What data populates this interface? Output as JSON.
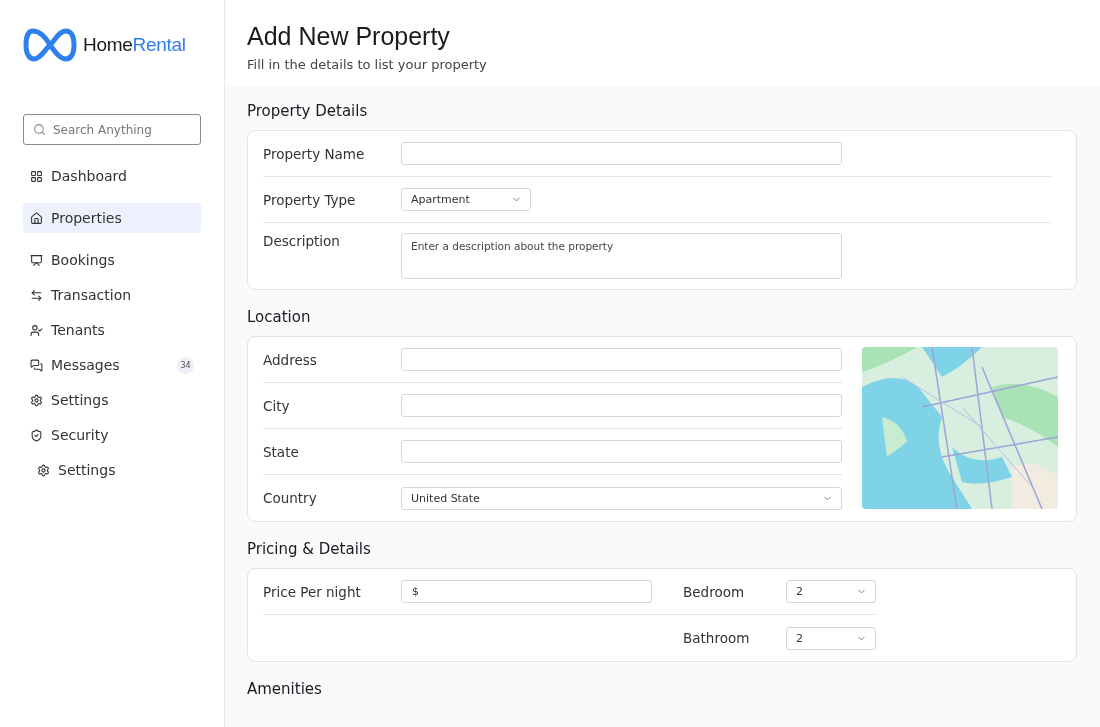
{
  "brand": {
    "first": "Home",
    "second": "Rental"
  },
  "search": {
    "placeholder": "Search Anything"
  },
  "nav": [
    {
      "label": "Dashboard",
      "selected": false
    },
    {
      "label": "Properties",
      "selected": true
    },
    {
      "label": "Bookings",
      "selected": false
    },
    {
      "label": "Transaction",
      "selected": false
    },
    {
      "label": "Tenants",
      "selected": false
    },
    {
      "label": "Messages",
      "selected": false,
      "badge": "34"
    },
    {
      "label": "Settings",
      "selected": false
    },
    {
      "label": "Security",
      "selected": false,
      "children": [
        {
          "label": "Settings",
          "selected": false
        }
      ]
    }
  ],
  "header": {
    "title": "Add New Property",
    "subtitle": "Fill in the details to list your property"
  },
  "sections": [
    {
      "title": "Property Details",
      "kind": "fields",
      "rows": [
        {
          "label": "Property Name",
          "kind": "text",
          "value": ""
        },
        {
          "label": "Property Type",
          "kind": "select",
          "value": "Apartment"
        },
        {
          "label": "Description",
          "kind": "textarea",
          "placeholder": "Enter a description about the property"
        }
      ]
    },
    {
      "title": "Location",
      "kind": "map",
      "rows": [
        {
          "label": "Address",
          "kind": "text",
          "value": ""
        },
        {
          "label": "City",
          "kind": "text",
          "value": ""
        },
        {
          "label": "State",
          "kind": "text",
          "value": ""
        },
        {
          "label": "Country",
          "kind": "select-wide",
          "value": "United State"
        }
      ]
    },
    {
      "title": "Pricing & Details",
      "kind": "pricing",
      "price": {
        "label": "Price Per night",
        "value": "$"
      },
      "selects": [
        {
          "label": "Bedroom",
          "value": "2"
        },
        {
          "label": "Bathroom",
          "value": "2"
        }
      ]
    },
    {
      "title": "Amenities",
      "kind": "heading"
    }
  ]
}
